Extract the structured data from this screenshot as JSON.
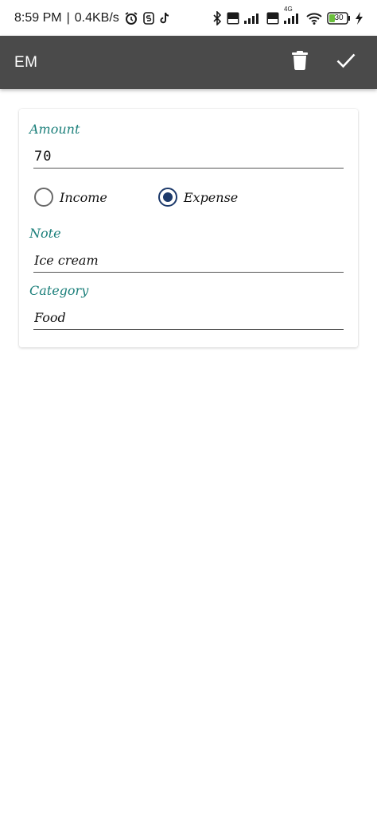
{
  "status_bar": {
    "time": "8:59 PM",
    "separator": "|",
    "speed": "0.4KB/s",
    "network_type": "4G",
    "battery": "30",
    "icons": [
      "alarm-icon",
      "s-app-icon",
      "tiktok-icon",
      "bluetooth-icon",
      "volte-icon",
      "signal-icon",
      "volte-icon",
      "signal-4g-icon",
      "wifi-icon",
      "battery-icon",
      "charging-icon"
    ]
  },
  "toolbar": {
    "title": "EM",
    "actions": [
      "delete-icon",
      "check-icon"
    ]
  },
  "form": {
    "amount_label": "Amount",
    "amount_value": "70",
    "type_options": [
      {
        "label": "Income",
        "selected": false
      },
      {
        "label": "Expense",
        "selected": true
      }
    ],
    "note_label": "Note",
    "note_value": "Ice cream",
    "category_label": "Category",
    "category_value": "Food"
  },
  "colors": {
    "toolbar_bg": "#4a4a4a",
    "label_teal": "#1b7f7a",
    "radio_selected": "#1d3a6b",
    "battery_green": "#6abf3b"
  }
}
